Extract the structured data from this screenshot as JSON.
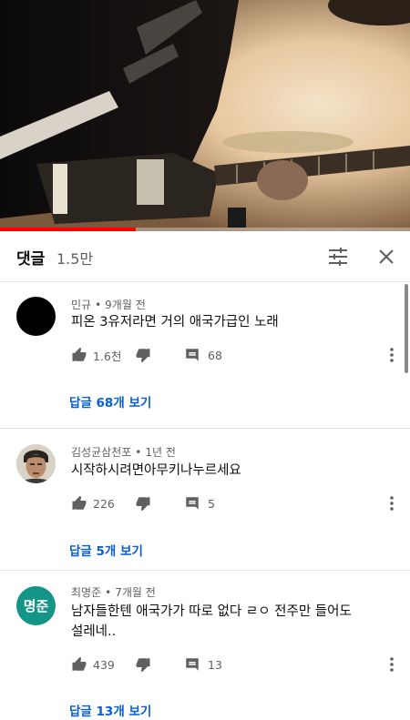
{
  "video": {
    "progress_percent": 33
  },
  "comments_header": {
    "title": "댓글",
    "count": "1.5만",
    "filter_icon": "sliders-icon",
    "close_icon": "close-icon"
  },
  "comments": [
    {
      "author": "민규",
      "separator": "•",
      "time": "9개월 전",
      "text_lines": [
        "피온 3유저라면 거의 애국가급인 노래"
      ],
      "likes": "1.6천",
      "reply_count": "68",
      "replies_link": "답글 68개 보기",
      "avatar_type": "black-circle"
    },
    {
      "author": "김성균삼천포",
      "separator": "•",
      "time": "1년 전",
      "text_lines": [
        "시작하시려면아무키나누르세요"
      ],
      "likes": "226",
      "reply_count": "5",
      "replies_link": "답글 5개 보기",
      "avatar_type": "photo-face"
    },
    {
      "author": "최명준",
      "separator": "•",
      "time": "7개월 전",
      "text_lines": [
        "남자들한텐 애국가가 따로 없다 ㄹㅇ 전주만 들어도",
        "설레네.."
      ],
      "likes": "439",
      "reply_count": "13",
      "replies_link": "답글 13개 보기",
      "avatar_type": "initials",
      "avatar_initials": "명준",
      "avatar_color": "#159488"
    }
  ],
  "colors": {
    "accent_link": "#065fd4",
    "progress": "#ff0000",
    "secondary_text": "#606060"
  }
}
